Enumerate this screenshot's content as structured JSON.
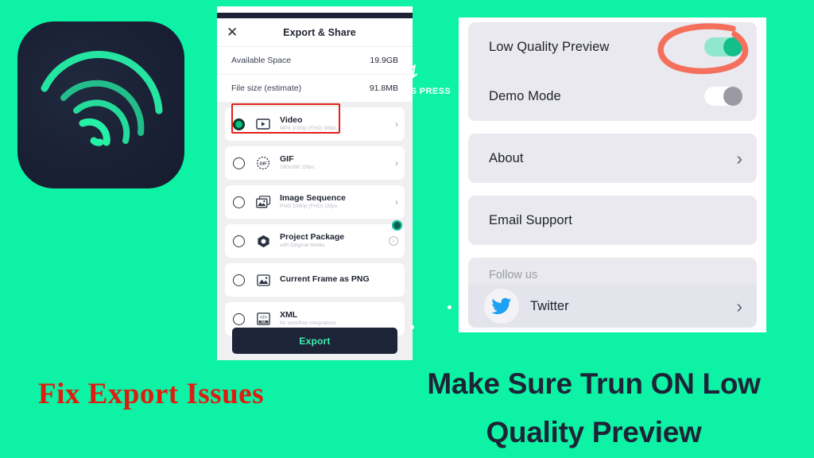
{
  "background_color": "#0df2a4",
  "logo": {
    "name": "alight-motion-app-icon",
    "tile_color": "#1b2236",
    "accent_color": "#26f0a6"
  },
  "export_sheet": {
    "close_icon_label": "✕",
    "title": "Export & Share",
    "info_rows": [
      {
        "label": "Available Space",
        "value": "19.9GB"
      },
      {
        "label": "File size (estimate)",
        "value": "91.8MB"
      }
    ],
    "options": [
      {
        "title": "Video",
        "subtitle": "MP4 1080p (FHD) 30fps",
        "icon": "video-icon",
        "selected": true,
        "chevron": "›",
        "highlighted": true,
        "badge": false,
        "info": false
      },
      {
        "title": "GIF",
        "subtitle": "180x390 15fps",
        "icon": "gif-icon",
        "selected": false,
        "chevron": "›",
        "highlighted": false,
        "badge": false,
        "info": false
      },
      {
        "title": "Image Sequence",
        "subtitle": "PNG 1080p (FHD) 15fps",
        "icon": "image-sequence-icon",
        "selected": false,
        "chevron": "›",
        "highlighted": false,
        "badge": false,
        "info": false
      },
      {
        "title": "Project Package",
        "subtitle": "with Original Media",
        "icon": "project-package-icon",
        "selected": false,
        "chevron": "",
        "highlighted": false,
        "badge": true,
        "info": true
      },
      {
        "title": "Current Frame as PNG",
        "subtitle": "",
        "icon": "picture-icon",
        "selected": false,
        "chevron": "",
        "highlighted": false,
        "badge": false,
        "info": false
      },
      {
        "title": "XML",
        "subtitle": "for workflow integrations",
        "icon": "xml-icon",
        "selected": false,
        "chevron": "",
        "highlighted": false,
        "badge": false,
        "info": false
      }
    ],
    "export_button_label": "Export",
    "highlight_color": "#e32119"
  },
  "watermark": {
    "glyph": "↯",
    "text": "MS PRESS"
  },
  "settings_panel": {
    "toggles": [
      {
        "label": "Low Quality Preview",
        "state": "on",
        "circled": true
      },
      {
        "label": "Demo Mode",
        "state": "off",
        "circled": false
      }
    ],
    "links": [
      {
        "label": "About",
        "chevron": "›"
      },
      {
        "label": "Email Support",
        "chevron": ""
      }
    ],
    "follow_us_label": "Follow us",
    "social": [
      {
        "name": "Twitter",
        "icon": "twitter-icon",
        "chevron": "›",
        "color": "#1da1f2"
      }
    ],
    "annotation_color": "#f4705c"
  },
  "captions": {
    "left": "Fix Export Issues",
    "right_line1": "Make Sure Trun ON Low",
    "right_line2": "Quality Preview",
    "left_color": "#e01b10",
    "right_color": "#1d2436"
  }
}
